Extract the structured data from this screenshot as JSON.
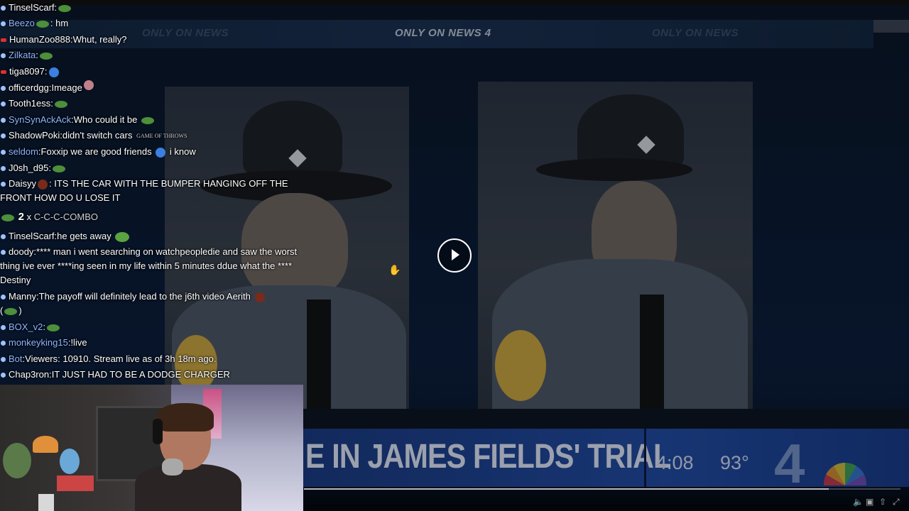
{
  "video": {
    "only_on_main": "ONLY ON NEWS 4",
    "only_on_ghost": "ONLY ON NEWS",
    "lower_third_text": "E IN JAMES FIELDS' TRIAL",
    "time": "4:08",
    "temperature": "93°",
    "station": "4",
    "progress": 0.88
  },
  "chat": {
    "messages": [
      {
        "user": "TinselScarf",
        "text": ":",
        "user_color": "#ffffff",
        "badge": "dot"
      },
      {
        "user": "Beezo",
        "text": ": hm",
        "user_color": "#8fb5ff",
        "badge": "dot"
      },
      {
        "user": "HumanZoo888",
        "text": ":Whut, really?",
        "user_color": "#ffffff",
        "badge": "red"
      },
      {
        "user": "Zilkata",
        "text": ":",
        "user_color": "#8fb5ff",
        "badge": "dot"
      },
      {
        "user": "tiga8097",
        "text": ":",
        "user_color": "#ffffff",
        "badge": "red"
      },
      {
        "user": "officerdgg",
        "text": ":Imeage",
        "user_color": "#ffffff",
        "badge": "dot"
      },
      {
        "user": "Tooth1ess",
        "text": ":",
        "user_color": "#ffffff",
        "badge": "dot"
      },
      {
        "user": "SynSynAckAck",
        "text": ":Who could it be",
        "user_color": "#8fb5ff",
        "badge": "dot"
      },
      {
        "user": "ShadowPoki",
        "text": ":didn't switch cars",
        "user_color": "#ffffff",
        "badge": "dot"
      },
      {
        "user": "seldom",
        "text": ":Foxxip we are good friends",
        "text2": "i know",
        "user_color": "#8fb5ff",
        "badge": "dot"
      },
      {
        "user": "J0sh_d95",
        "text": ":",
        "user_color": "#ffffff",
        "badge": "dot"
      },
      {
        "user": "Daisyy",
        "text": ": ITS THE CAR WITH THE BUMPER HANGING OFF THE FRONT HOW DO U LOSE IT",
        "user_color": "#ffffff",
        "badge": "dot"
      },
      {
        "user": "TinselScarf",
        "text": ":he gets away",
        "user_color": "#ffffff",
        "badge": "dot"
      },
      {
        "user": "doody",
        "text": ":**** man i went searching on watchpeopledie and saw the worst thing ive ever ****ing seen in my life within 5 minutes ddue what the **** Destiny",
        "user_color": "#ffffff",
        "badge": "dot"
      },
      {
        "user": "Manny",
        "text": ":The payoff will definitely lead to the j6th video Aerith",
        "text2": "(",
        "text3": ")",
        "user_color": "#ffffff",
        "badge": "dot"
      },
      {
        "user": "BOX_v2",
        "text": ":",
        "user_color": "#8fb5ff",
        "badge": "dot"
      },
      {
        "user": "monkeyking15",
        "text": ":!live",
        "user_color": "#8fb5ff",
        "badge": "dot"
      },
      {
        "user": "Bot",
        "text": ":Viewers: 10910. Stream live as of 3h 18m ago.",
        "user_color": "#8fb5ff",
        "badge": "dot"
      },
      {
        "user": "Chap3ron",
        "text": ":IT JUST HAD TO BE A DODGE CHARGER",
        "user_color": "#ffffff",
        "badge": "dot"
      }
    ],
    "combo": {
      "count": "2",
      "x": "x",
      "label": "C-C-C-COMBO"
    },
    "got_emote": "GAME OF THROWS"
  },
  "icons": {
    "play": "play-icon",
    "volume": "volume-icon",
    "captions": "captions-icon",
    "share": "share-icon",
    "fullscreen": "fullscreen-icon"
  },
  "colors": {
    "chat_user_blue": "#8fb5ff",
    "lower_third_blue": "#214aa0"
  }
}
